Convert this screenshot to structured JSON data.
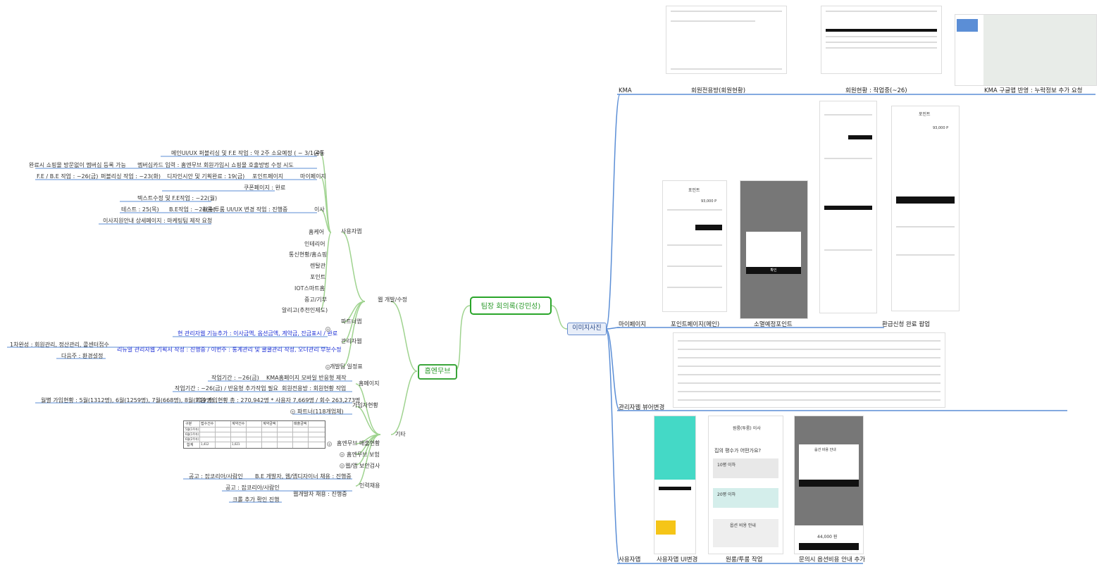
{
  "center": "팀장 회의록(강민성)",
  "left_root": "홈엔무브",
  "right_root": "이미지사진",
  "web_dev": {
    "label": "웹 개발/수정",
    "branches": {
      "user": "사용자앱",
      "partner": "파트너앱",
      "admin": "관리자웹",
      "schedule": "개발팀 일정표"
    },
    "common": {
      "label": "공통",
      "item": "메인UI/UX 퍼블리싱 및 F.E 작업 : 약 2주 소요예정 ( ~ 3/1(수)"
    },
    "mypage": {
      "label": "마이페이지",
      "membership": "멤버십카드 입력 : 홈엔무브 회원가입시 쇼핑몰 호출방법 수정 시도",
      "membership_note": "완료시 쇼핑몰 방문없이 멤버십 등록 가능",
      "points": "포인트페이지",
      "design": "디자인시안 및 기획완료 : 19(금)",
      "publish": "퍼블리싱 작업 : ~23(화)",
      "fe": "F.E / B.E 작업 : ~26(금)",
      "coupon": "쿠폰페이지 : 완료"
    },
    "moving": {
      "label": "이사",
      "work": "원룸/투룸 UI/UX 변경 작업 : 진행중",
      "text_fix": "텍스트수정 및 F.E작업 : ~22(월)",
      "be": "B.E작업 : ~24(수)",
      "test": "테스트 : 25(목)",
      "detail": "이사지원안내 상세페이지 : 마케팅팀 제작 요청"
    },
    "categories": [
      "홈케어",
      "인테리어",
      "통신현황/홈쇼핑",
      "렌탈관",
      "포인트",
      "IOT스마트홈",
      "중고/기부",
      "알리고(추천인제도)"
    ],
    "admin_items": {
      "feature": "현 관리자웹 기능추가 : 이사금액, 옵션금액, 계약금, 잔금표시 / 완료",
      "renewal": "리뉴얼 관리자웹 기획서 작성 : 진행중 / 이번주 : 통계관리 및 쿨쿨관리 작성, 오더관리 부분수정",
      "first": "1차완성 : 회원관리, 정산관리, 콜센터접수",
      "next": "다음주 : 환경설정"
    }
  },
  "etc": {
    "label": "기타",
    "homepage": "홈페이지",
    "kma_mobile": "KMA홈페이지 모바일 반응형 제작",
    "kma_period": "작업기간 : ~26(금)",
    "member_status": "회원전용방 : 회원현황 작업",
    "member_period": "작업기간 : ~26(금) / 반응형 추가작업 필요",
    "join_status": "가입자현황",
    "join_total": "회원 가입현황 총 : 270,942명 * 사용자 7,669명 / 회수 263,273명",
    "join_monthly": "월별 가입현황 : 5월(1312명), 6월(1259명), 7월(668명), 8월(719명)",
    "partner_count": "파트너(118개업체)",
    "sales": "홈엔무브 매출현황",
    "insurance": "홈엔무브 보험",
    "security": "웹/앱 보안검사",
    "hiring": "인력채용",
    "be_dev": "B.E 개발자, 웹/앱디자이너 채용 : 진행중",
    "be_notice": "공고 : 잡코리아/사람인",
    "web_dev": "웹개발자 채용 : 진행중",
    "web_notice": "공고 : 잡코리아/사람인",
    "crawling": "크롤 추가 확인 진행"
  },
  "sales_table": {
    "header": [
      "구분",
      "접수건수",
      "",
      "계약건수",
      "",
      "계약금액",
      "",
      "매출금액",
      ""
    ],
    "rows": [
      [
        "5월(1주차)",
        "473",
        "22",
        "243",
        "22",
        "24",
        "2",
        "210",
        "76"
      ],
      [
        "6월(1주차)",
        "465",
        "16",
        "229",
        "11",
        "13",
        "2",
        "216",
        "0"
      ],
      [
        "6월(2주차)",
        "467",
        "19",
        "302",
        "11",
        "12",
        "0",
        "290",
        "111"
      ],
      [
        "합계",
        "1,412",
        "66",
        "1,021",
        "44",
        "53",
        "5",
        "918",
        "38"
      ]
    ]
  },
  "images": {
    "kma": "KMA",
    "kma_members": "회원전용방(회원현황)",
    "kma_members_wip": "회원현황 : 작업중(~26)",
    "kma_google": "KMA 구글맵 반영 : 누락정보 추가 요청",
    "mypage": "마이페이지",
    "points_main": "포인트페이지(메인)",
    "points_expire": "소멸예정포인트",
    "refund_popup": "환급신청 완료 팝업",
    "admin_change": "관리자웹 뷰어변경",
    "user": "사용자앱",
    "user_ui": "사용자앱 UI변경",
    "room_work": "원룸/투룸 작업",
    "option_notice": "문의시 옵션비용 안내 추가"
  },
  "screens": {
    "points_title": "포인트",
    "points_value": "93,000 P",
    "confirm": "확인",
    "room_question": "집의 평수가 어떤가요?",
    "room_10": "10평 이하",
    "room_20": "20평 이하",
    "option_guide": "옵션 비용 안내",
    "price": "44,000 원",
    "moving_title": "원룸(투룸) 이사"
  },
  "colors": {
    "green": "#2aa52a",
    "blue_line": "#5b8ed6",
    "label_blue": "#1d2fd6"
  }
}
